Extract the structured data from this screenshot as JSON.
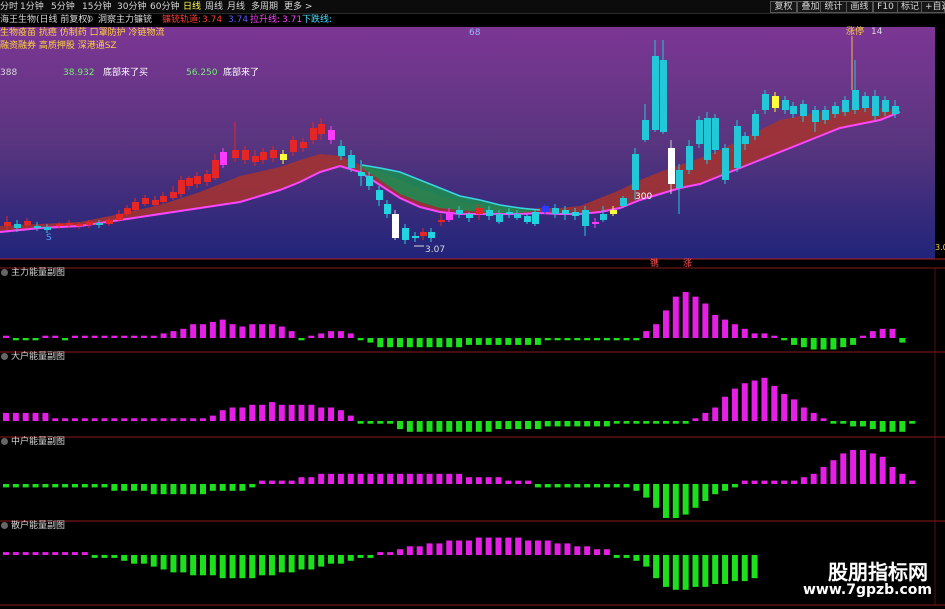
{
  "toolbar": {
    "periods": [
      "分时",
      "1分钟",
      "5分钟",
      "15分钟",
      "30分钟",
      "60分钟",
      "日线",
      "周线",
      "月线",
      "多周期",
      "更多 >"
    ],
    "active_period": "日线",
    "buttons": [
      "复权",
      "叠加",
      "统计",
      "画线",
      "F10",
      "标记",
      "+自选"
    ]
  },
  "titlebar": {
    "stock": "海王生物(日线 前复权)",
    "indicator": "洞察主力镰铳",
    "line1_label": "镰铳轨道:",
    "line1_value": "3.74",
    "line2_value": "3.74",
    "line3_label": "拉升线:",
    "line3_value": "3.71",
    "line4_label": "下跌线:"
  },
  "main": {
    "concepts_line1": "生物疫苗 抗癌 仿制药 口罩防护 冷链物流",
    "concepts_line2": "融资融券 高质押股 深港通SZ",
    "y_label_left": "388",
    "value_a": "38.932",
    "signal_a": "底部来了买",
    "value_b": "56.250",
    "signal_b": "底部来了",
    "top_marker": "68",
    "top_right_label": "涨停",
    "top_right_num": "14",
    "low_price": "3.07",
    "marker_300": "300",
    "s_marker": "S",
    "right_edge_price": "3.0",
    "bottom_tag_1": "镌",
    "bottom_tag_2": "涨"
  },
  "subcharts": [
    {
      "title": "主力能量副图"
    },
    {
      "title": "大户能量副图"
    },
    {
      "title": "中户能量副图"
    },
    {
      "title": "散户能量副图"
    }
  ],
  "watermark": {
    "cn": "股朋指标网",
    "url": "www.7gpzb.com"
  },
  "chart_data": [
    {
      "type": "candlestick",
      "title": "",
      "annotations": [
        "底部来了买",
        "底部来了",
        "3.07",
        "300",
        "涨停"
      ]
    },
    {
      "type": "bar",
      "title": "主力能量副图",
      "values": [
        1,
        -1,
        -1,
        -1,
        1,
        1,
        -1,
        1,
        1,
        1,
        1,
        1,
        1,
        1,
        1,
        1,
        2,
        3,
        4,
        6,
        6,
        7,
        8,
        6,
        5,
        6,
        6,
        6,
        5,
        3,
        -1,
        1,
        2,
        3,
        3,
        2,
        -1,
        -2,
        -4,
        -4,
        -4,
        -4,
        -4,
        -4,
        -4,
        -4,
        -4,
        -3,
        -3,
        -3,
        -3,
        -3,
        -3,
        -3,
        -3,
        -1,
        -1,
        -1,
        -1,
        -1,
        -1,
        -1,
        -1,
        -1,
        -1,
        3,
        6,
        12,
        18,
        20,
        18,
        15,
        10,
        8,
        6,
        4,
        2,
        2,
        1,
        -1,
        -3,
        -4,
        -5,
        -5,
        -5,
        -4,
        -3,
        1,
        3,
        4,
        4,
        -2
      ],
      "colors": {
        "positive": "#e51fe5",
        "negative": "#1ce01c"
      }
    },
    {
      "type": "bar",
      "title": "大户能量副图",
      "values": [
        3,
        3,
        3,
        3,
        3,
        1,
        1,
        1,
        1,
        1,
        1,
        1,
        1,
        1,
        1,
        1,
        1,
        1,
        1,
        1,
        1,
        2,
        4,
        5,
        5,
        6,
        6,
        7,
        6,
        6,
        6,
        6,
        5,
        5,
        4,
        2,
        -1,
        -1,
        -1,
        -1,
        -3,
        -4,
        -4,
        -4,
        -4,
        -4,
        -4,
        -4,
        -4,
        -4,
        -3,
        -3,
        -3,
        -3,
        -3,
        -2,
        -2,
        -2,
        -2,
        -2,
        -2,
        -2,
        -1,
        -1,
        -1,
        -1,
        -1,
        -1,
        -1,
        -1,
        1,
        3,
        5,
        9,
        12,
        14,
        15,
        16,
        13,
        10,
        8,
        5,
        3,
        1,
        -1,
        -1,
        -2,
        -2,
        -3,
        -4,
        -4,
        -4,
        -1
      ],
      "colors": {
        "positive": "#e51fe5",
        "negative": "#1ce01c"
      }
    },
    {
      "type": "bar",
      "title": "中户能量副图",
      "values": [
        -1,
        -1,
        -1,
        -1,
        -1,
        -1,
        -1,
        -1,
        -1,
        -1,
        -1,
        -2,
        -2,
        -2,
        -2,
        -3,
        -3,
        -3,
        -3,
        -3,
        -3,
        -2,
        -2,
        -2,
        -2,
        -1,
        1,
        1,
        1,
        1,
        2,
        2,
        3,
        3,
        3,
        3,
        3,
        3,
        3,
        3,
        3,
        3,
        3,
        3,
        3,
        3,
        3,
        2,
        2,
        2,
        2,
        1,
        1,
        1,
        -1,
        -1,
        -1,
        -1,
        -1,
        -1,
        -1,
        -1,
        -1,
        -1,
        -2,
        -4,
        -7,
        -10,
        -10,
        -9,
        -7,
        -5,
        -3,
        -2,
        -1,
        1,
        1,
        1,
        1,
        1,
        1,
        2,
        3,
        5,
        7,
        9,
        10,
        10,
        9,
        8,
        5,
        3,
        1
      ],
      "colors": {
        "positive": "#e51fe5",
        "negative": "#1ce01c"
      }
    },
    {
      "type": "bar",
      "title": "散户能量副图",
      "values": [
        1,
        1,
        1,
        1,
        1,
        1,
        1,
        1,
        1,
        -1,
        -1,
        -1,
        -2,
        -3,
        -3,
        -4,
        -5,
        -6,
        -6,
        -7,
        -7,
        -7,
        -8,
        -8,
        -8,
        -8,
        -7,
        -7,
        -6,
        -6,
        -5,
        -5,
        -4,
        -3,
        -3,
        -2,
        -1,
        -1,
        1,
        1,
        2,
        3,
        3,
        4,
        4,
        5,
        5,
        5,
        6,
        6,
        6,
        6,
        6,
        5,
        5,
        5,
        4,
        4,
        3,
        3,
        2,
        2,
        -1,
        -1,
        -2,
        -4,
        -8,
        -11,
        -12,
        -12,
        -11,
        -11,
        -10,
        -10,
        -9,
        -9,
        -8
      ],
      "colors": {
        "positive": "#e51fe5",
        "negative": "#1ce01c"
      }
    }
  ]
}
